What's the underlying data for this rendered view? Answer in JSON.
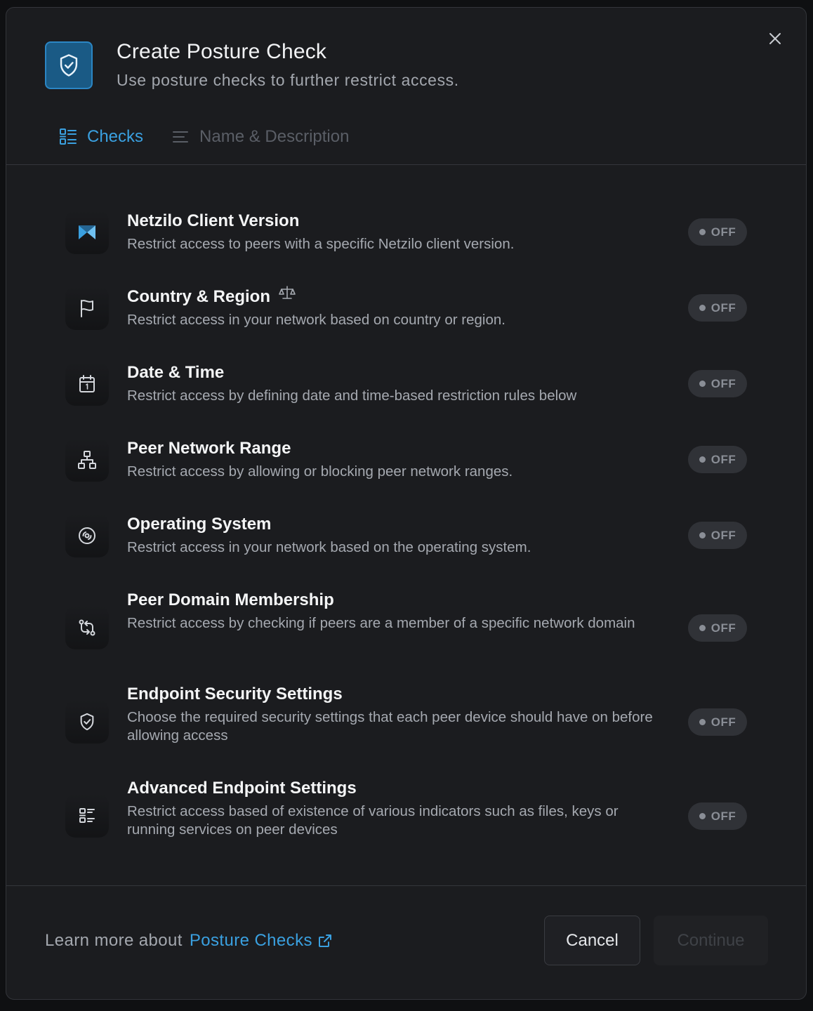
{
  "header": {
    "title": "Create Posture Check",
    "subtitle": "Use posture checks to further restrict access."
  },
  "tabs": [
    {
      "label": "Checks",
      "active": true
    },
    {
      "label": "Name & Description",
      "active": false
    }
  ],
  "checks": [
    {
      "icon": "netzilo-logo-icon",
      "title": "Netzilo Client Version",
      "description": "Restrict access to peers with a specific Netzilo client version.",
      "state": "OFF"
    },
    {
      "icon": "flag-icon",
      "title": "Country & Region",
      "badge_icon": "scale-icon",
      "description": "Restrict access in your network based on country or region.",
      "state": "OFF"
    },
    {
      "icon": "calendar-icon",
      "title": "Date & Time",
      "description": "Restrict access by defining date and time-based restriction rules below",
      "state": "OFF"
    },
    {
      "icon": "network-icon",
      "title": "Peer Network Range",
      "description": "Restrict access by allowing or blocking peer network ranges.",
      "state": "OFF"
    },
    {
      "icon": "disc-icon",
      "title": "Operating System",
      "description": "Restrict access in your network based on the operating system.",
      "state": "OFF"
    },
    {
      "icon": "domain-icon",
      "title": "Peer Domain Membership",
      "description": "Restrict access by checking if peers are a member of a specific network domain",
      "state": "OFF"
    },
    {
      "icon": "shield-check-icon",
      "title": "Endpoint Security Settings",
      "description": "Choose the required security settings that each peer device should have on before allowing access",
      "state": "OFF"
    },
    {
      "icon": "list-settings-icon",
      "title": "Advanced Endpoint Settings",
      "description": "Restrict access based of existence of various indicators such as files, keys or running services on peer devices",
      "state": "OFF"
    }
  ],
  "footer": {
    "learn_prefix": "Learn more about",
    "learn_link": "Posture Checks",
    "cancel": "Cancel",
    "continue": "Continue"
  },
  "colors": {
    "accent": "#3aa0e0",
    "background": "#1b1c1f",
    "toggle_off": "#303237"
  }
}
